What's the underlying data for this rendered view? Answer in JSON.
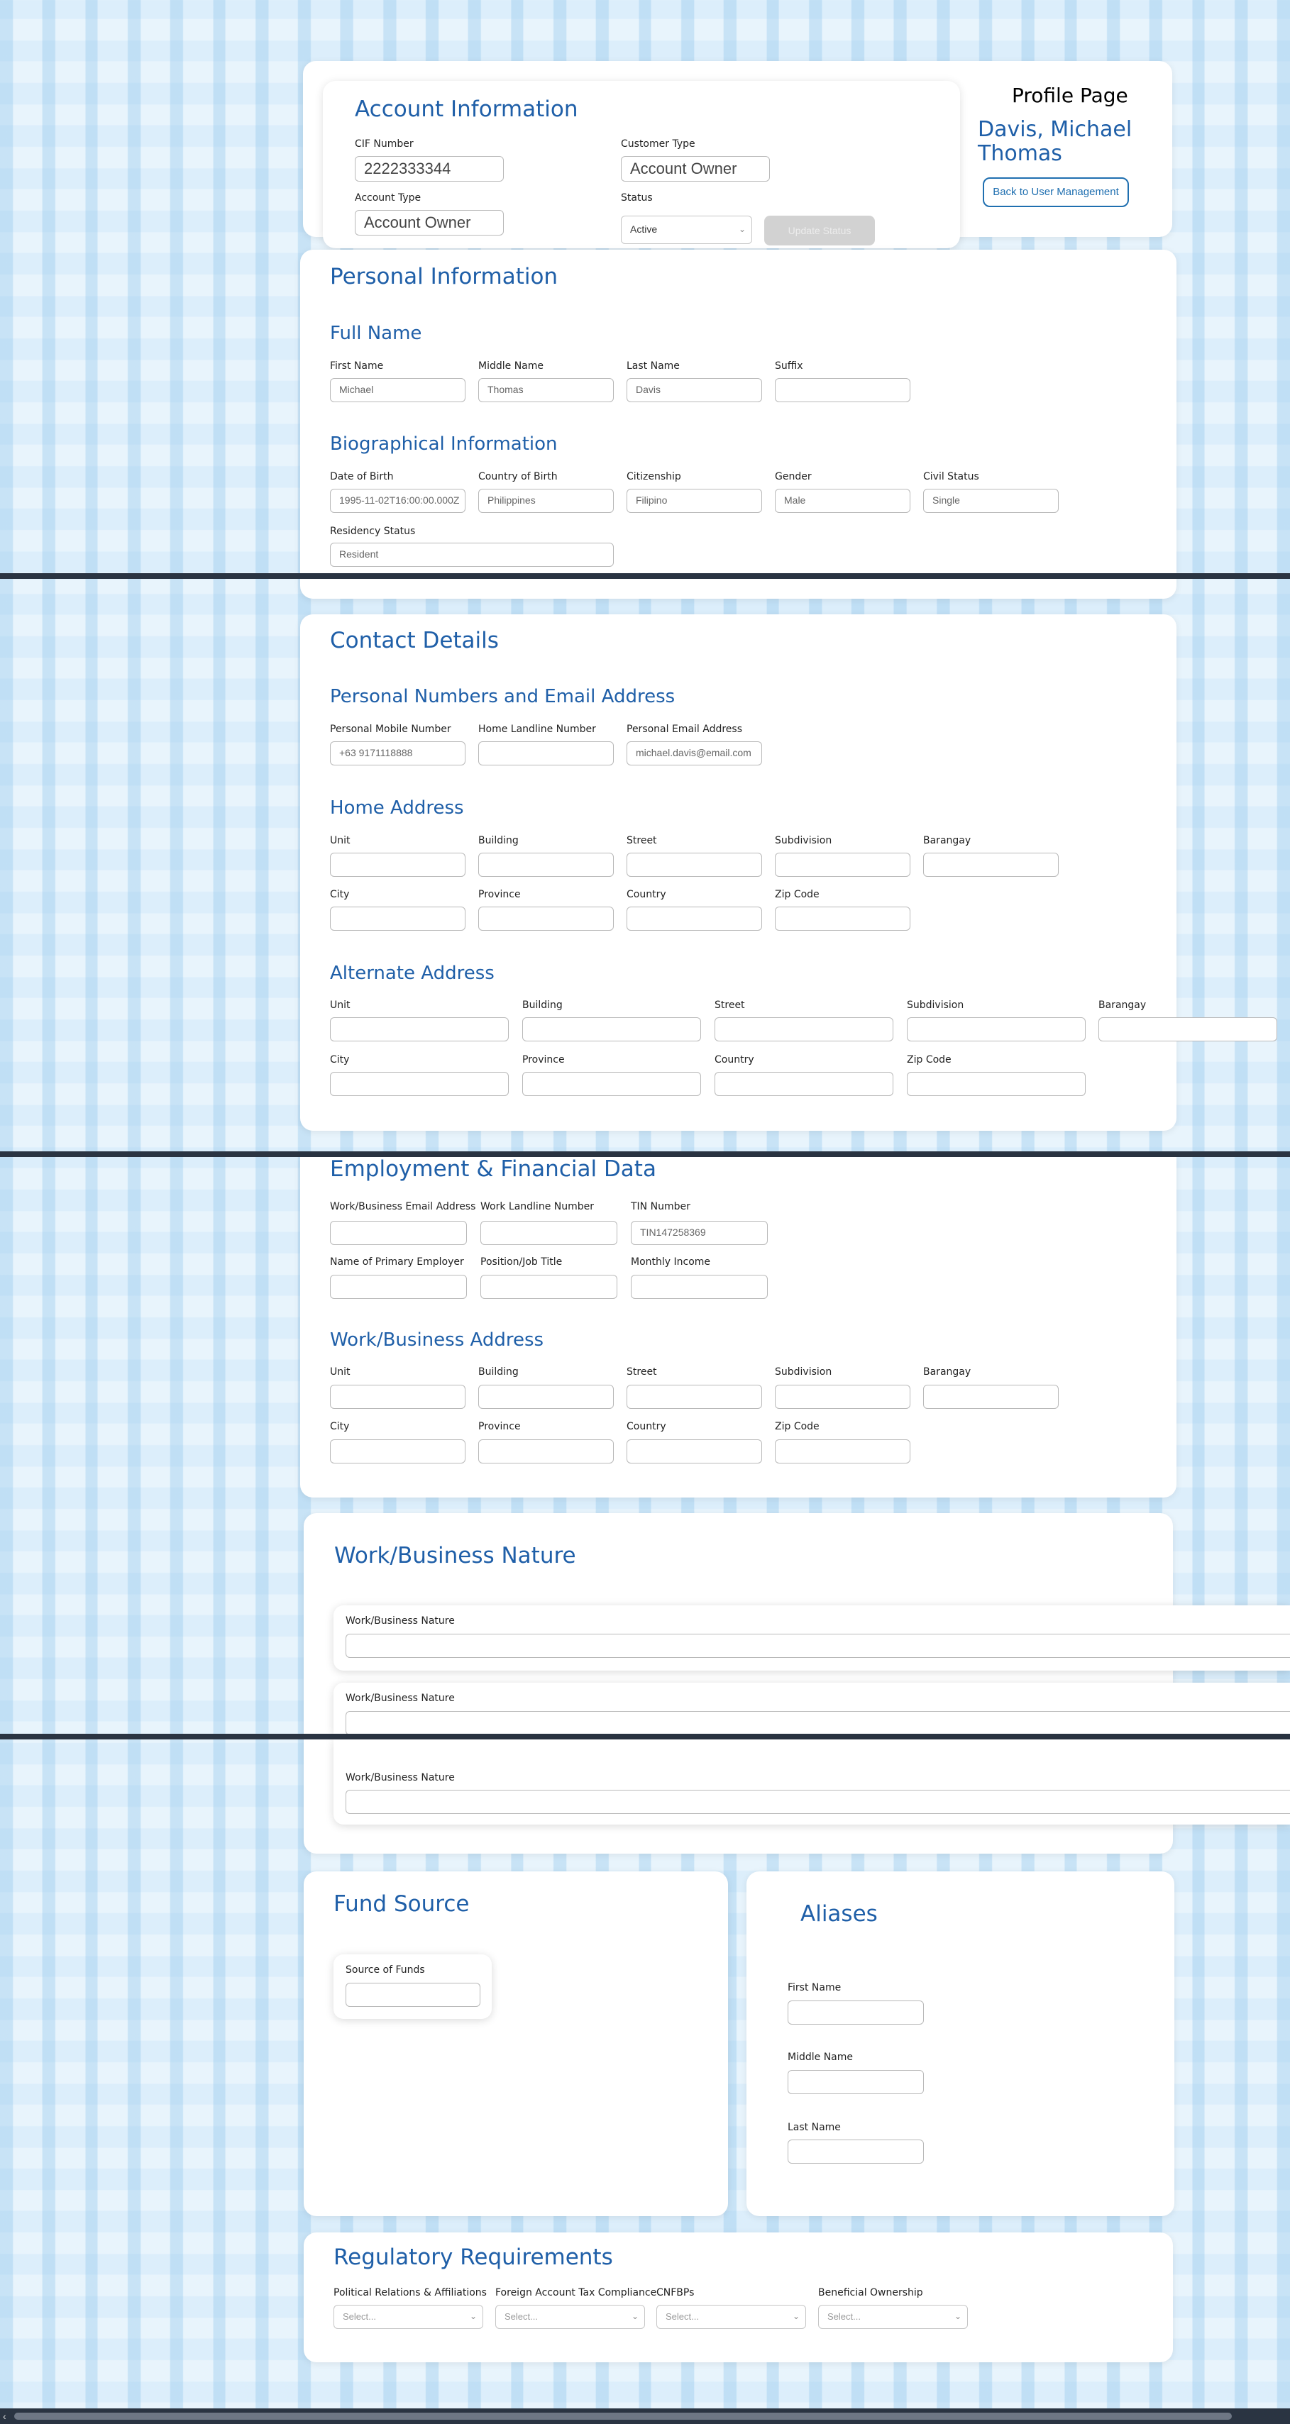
{
  "account": {
    "title": "Account Information",
    "cif_label": "CIF Number",
    "cif_value": "2222333344",
    "customer_type_label": "Customer Type",
    "customer_type_value": "Account Owner",
    "account_type_label": "Account Type",
    "account_type_value": "Account Owner",
    "status_label": "Status",
    "status_value": "Active",
    "update_button": "Update Status"
  },
  "profile": {
    "title": "Profile Page",
    "name_line1": "Davis, Michael",
    "name_line2": "Thomas",
    "back_button": "Back to User Management"
  },
  "personal": {
    "title": "Personal Information",
    "full_name_title": "Full Name",
    "first_name_label": "First Name",
    "first_name": "Michael",
    "middle_name_label": "Middle Name",
    "middle_name": "Thomas",
    "last_name_label": "Last Name",
    "last_name": "Davis",
    "suffix_label": "Suffix",
    "suffix": "",
    "bio_title": "Biographical Information",
    "dob_label": "Date of Birth",
    "dob": "1995-11-02T16:00:00.000Z",
    "cob_label": "Country of Birth",
    "cob": "Philippines",
    "citizenship_label": "Citizenship",
    "citizenship": "Filipino",
    "gender_label": "Gender",
    "gender": "Male",
    "civil_label": "Civil Status",
    "civil": "Single",
    "residency_label": "Residency Status",
    "residency": "Resident"
  },
  "contact": {
    "title": "Contact Details",
    "numbers_title": "Personal Numbers and Email Address",
    "mobile_label": "Personal Mobile Number",
    "mobile": "+63 9171118888",
    "landline_label": "Home Landline Number",
    "landline": "",
    "email_label": "Personal Email Address",
    "email": "michael.davis@email.com",
    "home_title": "Home Address",
    "alt_title": "Alternate Address",
    "unit": "Unit",
    "building": "Building",
    "street": "Street",
    "subdivision": "Subdivision",
    "barangay": "Barangay",
    "city": "City",
    "province": "Province",
    "country": "Country",
    "zip": "Zip Code"
  },
  "employment": {
    "title": "Employment & Financial Data",
    "work_email_label": "Work/Business Email Address",
    "work_landline_label": "Work Landline Number",
    "tin_label": "TIN Number",
    "tin": "TIN147258369",
    "employer_label": "Name of Primary Employer",
    "position_label": "Position/Job Title",
    "income_label": "Monthly Income",
    "work_address_title": "Work/Business Address"
  },
  "nature": {
    "title": "Work/Business Nature",
    "items": [
      "Work/Business Nature",
      "Work/Business Nature",
      "Work/Business Nature"
    ]
  },
  "fund": {
    "title": "Fund Source",
    "source_label": "Source of Funds"
  },
  "aliases": {
    "title": "Aliases",
    "first_label": "First Name",
    "middle_label": "Middle Name",
    "last_label": "Last Name"
  },
  "regulatory": {
    "title": "Regulatory Requirements",
    "pra_label": "Political Relations & Affiliations",
    "fatca_label": "Foreign Account Tax Compliance",
    "cnfbp_label": "CNFBPs",
    "bo_label": "Beneficial Ownership",
    "placeholder": "Select..."
  }
}
